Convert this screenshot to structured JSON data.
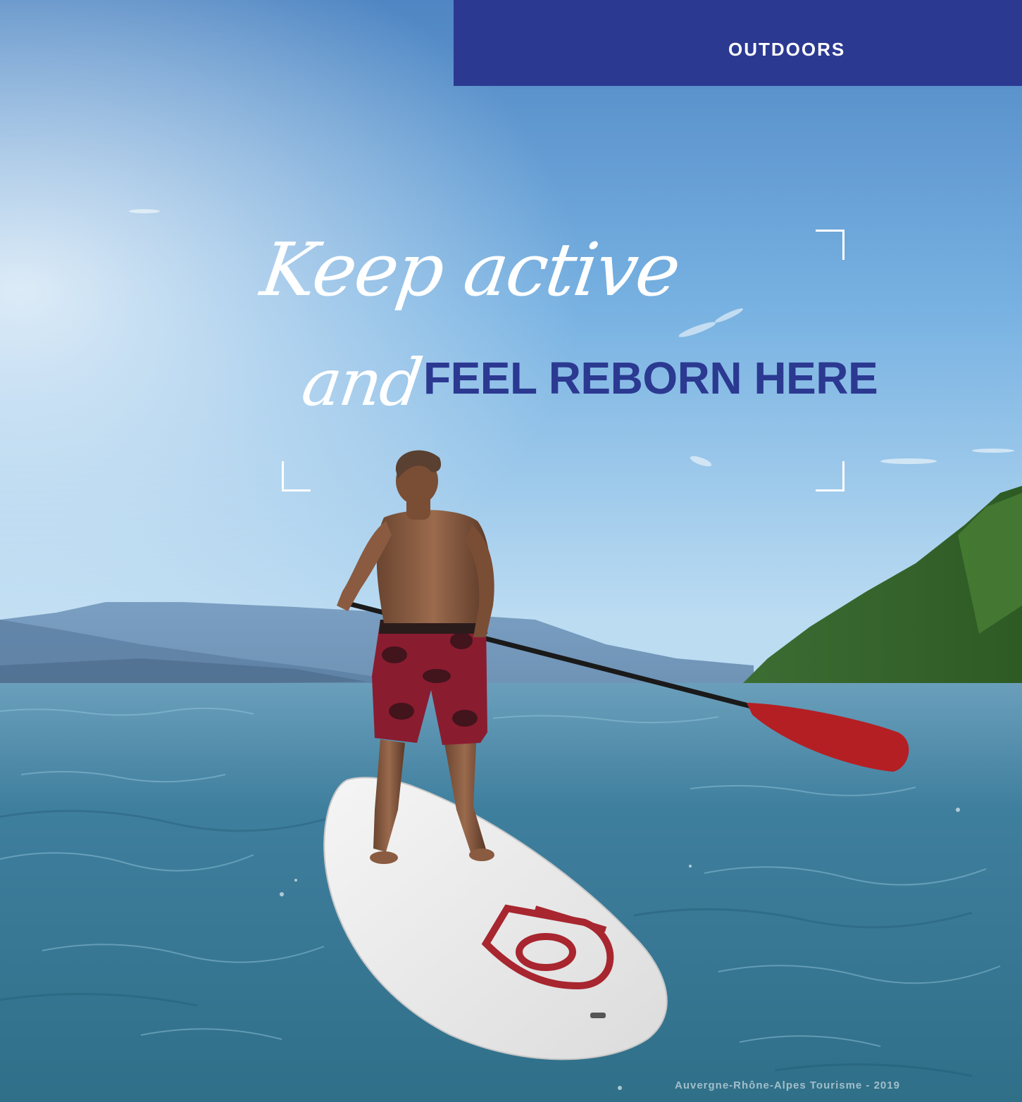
{
  "header": {
    "section_label": "OUTDOORS"
  },
  "headline": {
    "script_line1": "Keep active",
    "script_line2": "and",
    "bold_text": "FEEL REBORN HERE"
  },
  "footer": {
    "credit": "Auvergne-Rhône-Alpes Tourisme - 2019"
  },
  "colors": {
    "brand_blue": "#2b3991",
    "text_white": "#ffffff"
  }
}
